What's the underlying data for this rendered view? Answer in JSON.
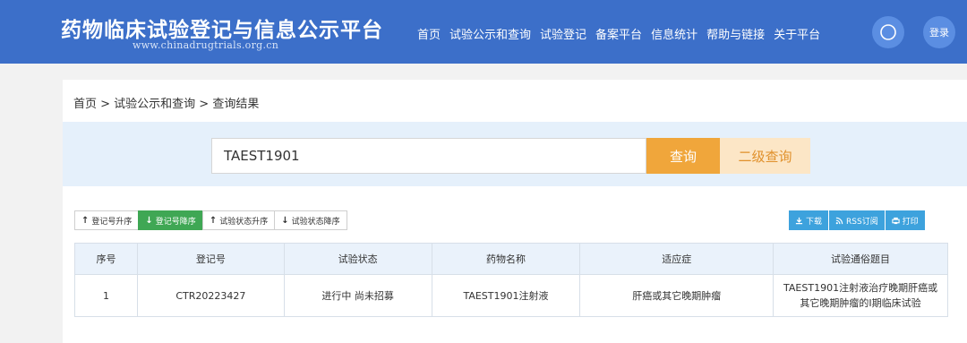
{
  "header": {
    "logo_title": "药物临床试验登记与信息公示平台",
    "logo_url": "www.chinadrugtrials.org.cn",
    "nav": [
      "首页",
      "试验公示和查询",
      "试验登记",
      "备案平台",
      "信息统计",
      "帮助与链接",
      "关于平台"
    ],
    "search_icon": "search-icon",
    "login_label": "登录",
    "bg_color": "#3c6fc9"
  },
  "breadcrumb": "首页 > 试验公示和查询 > 查询结果",
  "search": {
    "value": "TAEST1901",
    "query_label": "查询",
    "secondary_label": "二级查询"
  },
  "sorts": [
    {
      "icon": "arrow-up-icon",
      "label": "登记号升序",
      "active": false
    },
    {
      "icon": "arrow-down-icon",
      "label": "登记号降序",
      "active": true
    },
    {
      "icon": "arrow-up-icon",
      "label": "试验状态升序",
      "active": false
    },
    {
      "icon": "arrow-down-icon",
      "label": "试验状态降序",
      "active": false
    }
  ],
  "actions": [
    {
      "icon": "download-icon",
      "label": "下载"
    },
    {
      "icon": "rss-icon",
      "label": "RSS订阅"
    },
    {
      "icon": "print-icon",
      "label": "打印"
    }
  ],
  "table": {
    "headers": [
      "序号",
      "登记号",
      "试验状态",
      "药物名称",
      "适应症",
      "试验通俗题目"
    ],
    "rows": [
      [
        "1",
        "CTR20223427",
        "进行中 尚未招募",
        "TAEST1901注射液",
        "肝癌或其它晚期肿瘤",
        "TAEST1901注射液治疗晚期肝癌或其它晚期肿瘤的I期临床试验"
      ]
    ]
  }
}
